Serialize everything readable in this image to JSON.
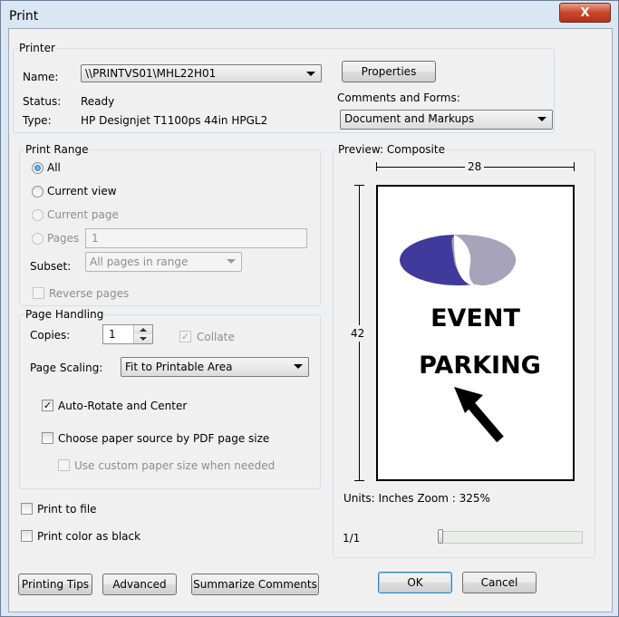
{
  "window": {
    "title": "Print",
    "close_label": "X"
  },
  "printer": {
    "legend": "Printer",
    "name_label": "Name:",
    "name_value": "\\\\PRINTVS01\\MHL22H01",
    "properties_label": "Properties",
    "status_label": "Status:",
    "status_value": "Ready",
    "type_label": "Type:",
    "type_value": "HP Designjet T1100ps 44in HPGL2",
    "comments_forms_label": "Comments and Forms:",
    "comments_forms_value": "Document and Markups"
  },
  "print_range": {
    "legend": "Print Range",
    "all_label": "All",
    "current_view_label": "Current view",
    "current_page_label": "Current page",
    "pages_label": "Pages",
    "pages_value": "1",
    "subset_label": "Subset:",
    "subset_value": "All pages in range",
    "reverse_pages_label": "Reverse pages",
    "selected": "All"
  },
  "page_handling": {
    "legend": "Page Handling",
    "copies_label": "Copies:",
    "copies_value": "1",
    "collate_label": "Collate",
    "collate_checked": true,
    "page_scaling_label": "Page Scaling:",
    "page_scaling_value": "Fit to Printable Area",
    "auto_rotate_label": "Auto-Rotate and Center",
    "auto_rotate_checked": true,
    "choose_source_label": "Choose paper source by PDF page size",
    "custom_size_label": "Use custom paper size when needed"
  },
  "options": {
    "print_to_file_label": "Print to file",
    "print_color_black_label": "Print color as black"
  },
  "preview": {
    "legend": "Preview: Composite",
    "width_dim": "28",
    "height_dim": "42",
    "sign_line1": "EVENT",
    "sign_line2": "PARKING",
    "units_zoom": "Units: Inches Zoom : 325%",
    "page_counter": "1/1",
    "logo_colors": {
      "left": "#3f3a9c",
      "right": "#a7a3bb"
    }
  },
  "buttons": {
    "printing_tips": "Printing Tips",
    "advanced": "Advanced",
    "summarize_comments": "Summarize Comments",
    "ok": "OK",
    "cancel": "Cancel"
  }
}
